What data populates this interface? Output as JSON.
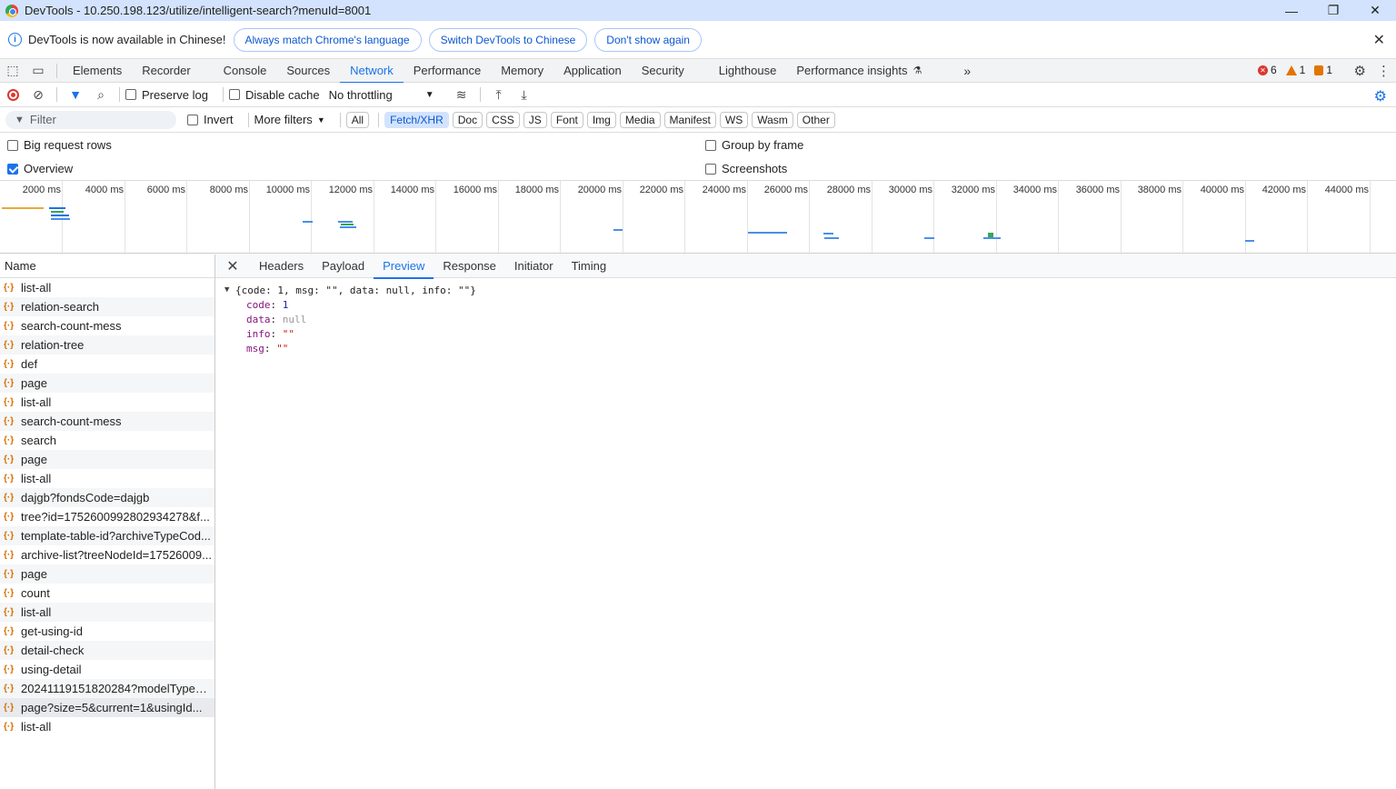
{
  "window": {
    "title": "DevTools - 10.250.198.123/utilize/intelligent-search?menuId=8001",
    "controls": [
      "—",
      "❐",
      "✕"
    ]
  },
  "infobar": {
    "message": "DevTools is now available in Chinese!",
    "btn_match": "Always match Chrome's language",
    "btn_switch": "Switch DevTools to Chinese",
    "btn_dont": "Don't show again"
  },
  "tabs": [
    "Elements",
    "Recorder",
    "Console",
    "Sources",
    "Network",
    "Performance",
    "Memory",
    "Application",
    "Security",
    "Lighthouse",
    "Performance insights"
  ],
  "active_tab": "Network",
  "counts": {
    "errors": "6",
    "warnings": "1",
    "issues": "1"
  },
  "toolbar": {
    "preserve_log": "Preserve log",
    "disable_cache": "Disable cache",
    "throttling": "No throttling"
  },
  "filterbar": {
    "placeholder": "Filter",
    "invert": "Invert",
    "more_filters": "More filters",
    "chips": [
      "All",
      "Fetch/XHR",
      "Doc",
      "CSS",
      "JS",
      "Font",
      "Img",
      "Media",
      "Manifest",
      "WS",
      "Wasm",
      "Other"
    ],
    "selected_chip": "Fetch/XHR"
  },
  "options": {
    "big_rows": "Big request rows",
    "overview": "Overview",
    "group_by_frame": "Group by frame",
    "screenshots": "Screenshots"
  },
  "overview": {
    "ticks": [
      "2000 ms",
      "4000 ms",
      "6000 ms",
      "8000 ms",
      "10000 ms",
      "12000 ms",
      "14000 ms",
      "16000 ms",
      "18000 ms",
      "20000 ms",
      "22000 ms",
      "24000 ms",
      "26000 ms",
      "28000 ms",
      "30000 ms",
      "32000 ms",
      "34000 ms",
      "36000 ms",
      "38000 ms",
      "40000 ms",
      "42000 ms",
      "44000 ms"
    ]
  },
  "requests": {
    "header": "Name",
    "items": [
      "list-all",
      "relation-search",
      "search-count-mess",
      "relation-tree",
      "def",
      "page",
      "list-all",
      "search-count-mess",
      "search",
      "page",
      "list-all",
      "dajgb?fondsCode=dajgb",
      "tree?id=1752600992802934278&f...",
      "template-table-id?archiveTypeCod...",
      "archive-list?treeNodeId=17526009...",
      "page",
      "count",
      "list-all",
      "get-using-id",
      "detail-check",
      "using-detail",
      "20241119151820284?modelTypeC...",
      "page?size=5&current=1&usingId...",
      "list-all"
    ],
    "selected_index": 22
  },
  "detail": {
    "tabs": [
      "Headers",
      "Payload",
      "Preview",
      "Response",
      "Initiator",
      "Timing"
    ],
    "active": "Preview",
    "summary": "{code: 1, msg: \"\", data: null, info: \"\"}",
    "fields": [
      {
        "key": "code",
        "value": "1",
        "kind": "num"
      },
      {
        "key": "data",
        "value": "null",
        "kind": "nul"
      },
      {
        "key": "info",
        "value": "\"\"",
        "kind": "str"
      },
      {
        "key": "msg",
        "value": "\"\"",
        "kind": "str"
      }
    ]
  }
}
